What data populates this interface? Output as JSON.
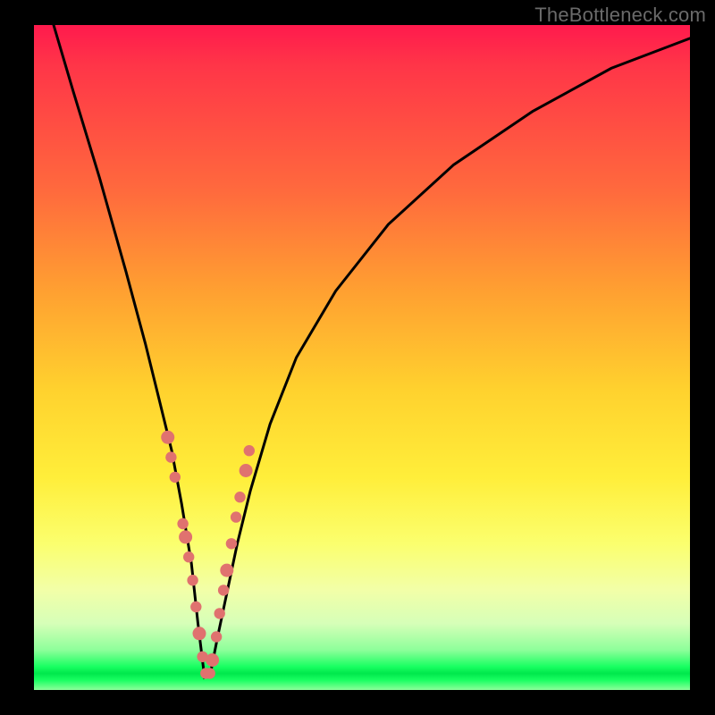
{
  "watermark": "TheBottleneck.com",
  "colors": {
    "background": "#000000",
    "curve": "#000000",
    "marker": "#e0726f",
    "gradient_top": "#ff1a4d",
    "gradient_mid": "#ffd22e",
    "gradient_green": "#00e84c"
  },
  "chart_data": {
    "type": "line",
    "title": "",
    "xlabel": "",
    "ylabel": "",
    "xlim": [
      0,
      100
    ],
    "ylim": [
      0,
      100
    ],
    "note": "Axes have no tick labels in the source image; x/y are normalized 0–100 percent of the plot area. The curve is a V-shaped bottleneck profile: a steep descent from top-left into a sharp minimum near x≈26, then a slower concave rise toward the top-right.",
    "series": [
      {
        "name": "bottleneck-curve",
        "x": [
          3,
          6,
          10,
          14,
          17,
          19,
          21,
          22.5,
          24,
          25,
          26,
          27,
          28,
          29.5,
          31,
          33,
          36,
          40,
          46,
          54,
          64,
          76,
          88,
          100
        ],
        "y": [
          100,
          90,
          77,
          63,
          52,
          44,
          36,
          28,
          19,
          10,
          2,
          3,
          8,
          15,
          22,
          30,
          40,
          50,
          60,
          70,
          79,
          87,
          93.5,
          98
        ]
      }
    ],
    "markers": {
      "name": "highlighted-points",
      "comment": "Salmon-colored dot clusters along the lower part of both arms and across the trough.",
      "x": [
        20.4,
        20.9,
        21.5,
        22.7,
        23.1,
        23.6,
        24.2,
        24.7,
        25.2,
        25.7,
        26.2,
        26.8,
        27.2,
        27.8,
        28.3,
        28.9,
        29.4,
        30.1,
        30.8,
        31.4,
        32.3,
        32.8
      ],
      "y": [
        38,
        35,
        32,
        25,
        23,
        20,
        16.5,
        12.5,
        8.5,
        5,
        2.5,
        2.5,
        4.5,
        8,
        11.5,
        15,
        18,
        22,
        26,
        29,
        33,
        36
      ]
    }
  }
}
